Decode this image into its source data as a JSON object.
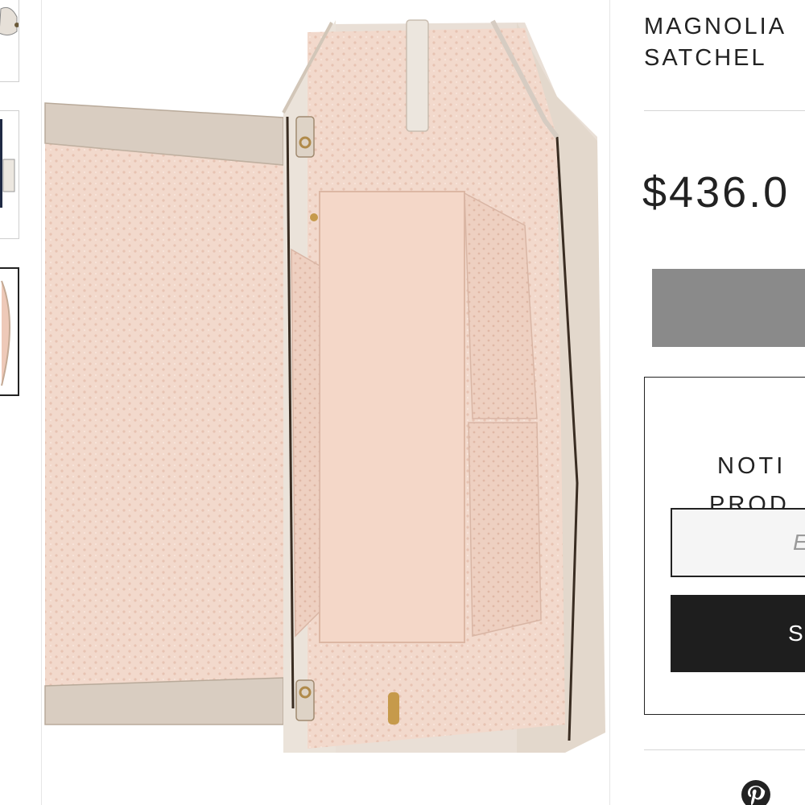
{
  "product": {
    "title": "MAGNOLIA\nSATCHEL",
    "price": "$436.0"
  },
  "cart": {
    "button_label": ""
  },
  "notify": {
    "heading_line1": "NOTI",
    "heading_line2": "PROD",
    "email_placeholder": "E",
    "subscribe_label": "S"
  },
  "share": {
    "icons": [
      "pinterest-icon"
    ]
  },
  "gallery": {
    "thumbnails": [
      "thumbnail-1",
      "thumbnail-2",
      "thumbnail-3"
    ],
    "active_thumbnail_index": 2,
    "main_image": "open satchel interior with pink logo-print lining"
  },
  "colors": {
    "lining": "#f2d9cc",
    "leather": "#d8cbbd",
    "add_to_cart_bg": "#8a8a8a",
    "subscribe_bg": "#1e1e1e",
    "text": "#222222",
    "pinterest": "#222222"
  }
}
